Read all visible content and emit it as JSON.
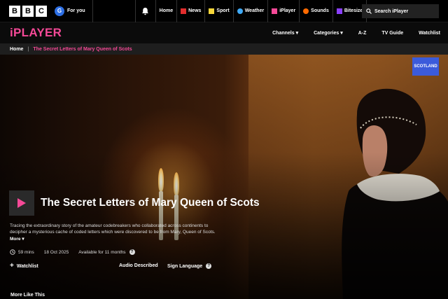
{
  "global_nav": {
    "logo_letters": [
      "B",
      "B",
      "C"
    ],
    "for_you": {
      "icon_letter": "G",
      "label": "For you"
    },
    "links": [
      {
        "label": "Home",
        "icon": "",
        "color": ""
      },
      {
        "label": "News",
        "icon": "news-icon",
        "color": "#e22d2d"
      },
      {
        "label": "Sport",
        "icon": "sport-icon",
        "color": "#f6d63a"
      },
      {
        "label": "Weather",
        "icon": "weather-icon",
        "color": "#3fa9f5"
      },
      {
        "label": "iPlayer",
        "icon": "iplayer-icon",
        "color": "#f54997"
      },
      {
        "label": "Sounds",
        "icon": "sounds-icon",
        "color": "#ff6a00"
      },
      {
        "label": "Bitesize",
        "icon": "bitesize-icon",
        "color": "#8a3ffc"
      }
    ],
    "search_label": "Search iPlayer"
  },
  "iplayer_nav": {
    "brand": "iPLAYER",
    "brand_color": "#f54997",
    "links": [
      "Channels ▾",
      "Categories ▾",
      "A-Z",
      "TV Guide",
      "Watchlist"
    ]
  },
  "breadcrumb": {
    "home": "Home",
    "current": "The Secret Letters of Mary Queen of Scots"
  },
  "hero": {
    "badge": "SCOTLAND",
    "badge_color": "#3b5bdb",
    "title": "The Secret Letters of Mary Queen of Scots",
    "description": "Tracing the extraordinary story of the amateur codebreakers who collaborated across continents to decipher a mysterious cache of coded letters which were discovered to be from Mary, Queen of Scots.",
    "more_label": "More",
    "duration": "59 mins",
    "date": "18 Oct 2025",
    "availability": "Available for 11 months",
    "watchlist_label": "Watchlist",
    "audio_described_label": "Audio Described",
    "sign_language_label": "Sign Language"
  },
  "section_title": "More Like This"
}
